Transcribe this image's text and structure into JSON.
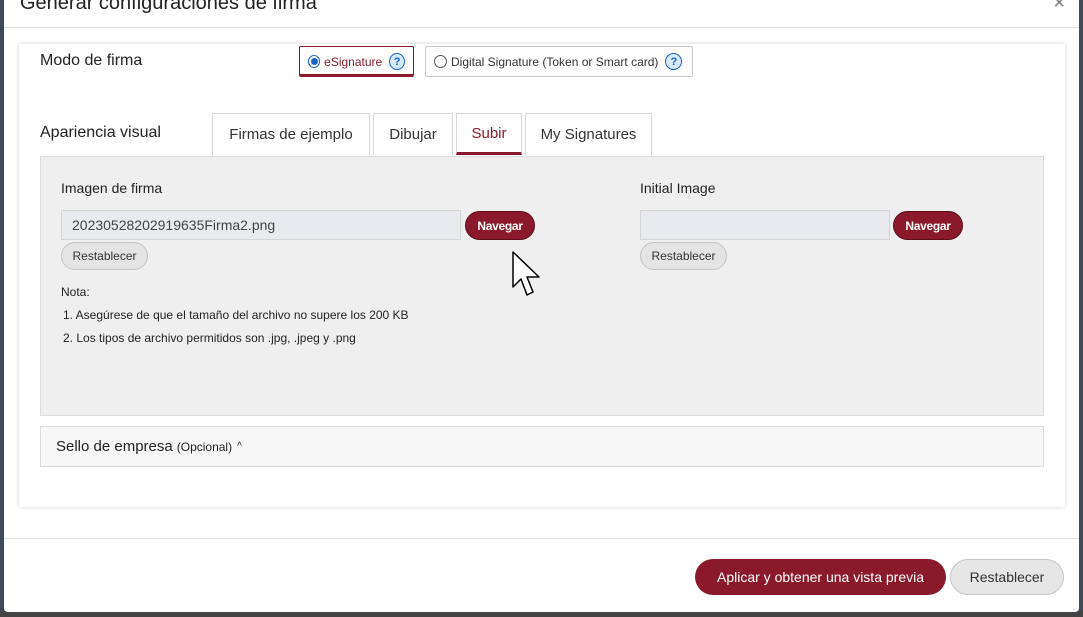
{
  "modal": {
    "title": "Generar configuraciones de firma",
    "close": "×"
  },
  "signature_mode": {
    "label": "Modo de firma",
    "options": [
      {
        "label": "eSignature",
        "selected": true,
        "help": "?"
      },
      {
        "label": "Digital Signature (Token or Smart card)",
        "selected": false,
        "help": "?"
      }
    ]
  },
  "appearance": {
    "label": "Apariencia visual",
    "tabs": [
      {
        "label": "Firmas de ejemplo",
        "active": false
      },
      {
        "label": "Dibujar",
        "active": false
      },
      {
        "label": "Subir",
        "active": true
      },
      {
        "label": "My Signatures",
        "active": false
      }
    ]
  },
  "upload": {
    "signature_image": {
      "label": "Imagen de firma",
      "value": "20230528202919635Firma2.png",
      "browse": "Navegar",
      "reset": "Restablecer"
    },
    "initial_image": {
      "label": "Initial Image",
      "value": "",
      "browse": "Navegar",
      "reset": "Restablecer"
    },
    "note": {
      "title": "Nota:",
      "items": [
        "1. Asegúrese de que el tamaño del archivo no supere los 200 KB",
        "2. Los tipos de archivo permitidos son .jpg, .jpeg y .png"
      ]
    }
  },
  "company_seal": {
    "title": "Sello de empresa",
    "optional": "(Opcional)",
    "chevron": "^"
  },
  "footer": {
    "apply": "Aplicar y obtener una vista previa",
    "reset": "Restablecer"
  },
  "colors": {
    "accent": "#8a1a2b",
    "help_blue": "#1a62c9"
  }
}
